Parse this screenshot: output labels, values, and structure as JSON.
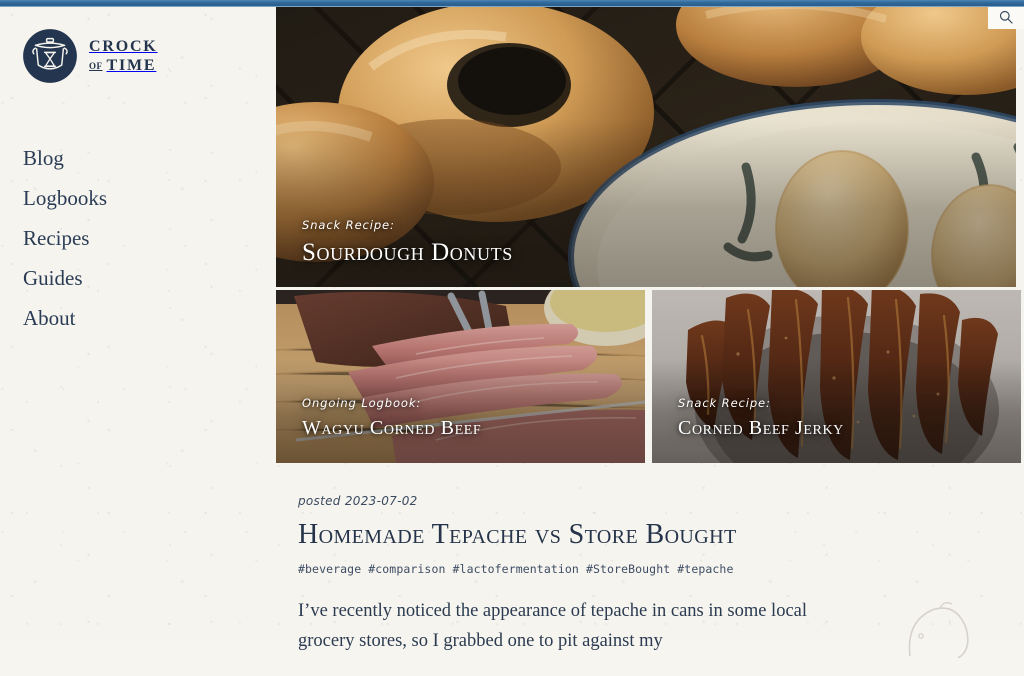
{
  "site": {
    "logo": {
      "icon": "crock-hourglass-icon",
      "line1": "CROCK",
      "of": "OF",
      "line2": "TIME"
    },
    "brand_color": "#24364f",
    "paper_color": "#f6f4ee",
    "topbar_color": "#2f6899"
  },
  "search": {
    "icon": "search-icon",
    "label": "Search"
  },
  "nav": {
    "items": [
      {
        "label": "Blog"
      },
      {
        "label": "Logbooks"
      },
      {
        "label": "Recipes"
      },
      {
        "label": "Guides"
      },
      {
        "label": "About"
      }
    ]
  },
  "features": {
    "hero": {
      "kicker": "Snack Recipe:",
      "title": "Sourdough Donuts",
      "image_description": "Golden glazed sourdough donuts cooling on a dark wire rack beside a blue-rimmed ceramic bowl of sugar-coated donut holes"
    },
    "secondary": [
      {
        "kicker": "Ongoing Logbook:",
        "title": "Wagyu Corned Beef",
        "image_description": "Sliced pink wagyu corned beef on a wooden cutting board with metal tongs"
      },
      {
        "kicker": "Snack Recipe:",
        "title": "Corned Beef Jerky",
        "image_description": "Dark reddish-brown corned beef jerky strips piled in a grey bowl"
      }
    ]
  },
  "post": {
    "date_prefix": "posted",
    "date": "2023-07-02",
    "date_full": "posted 2023-07-02",
    "title": "Homemade Tepache vs Store Bought",
    "tags": "#beverage #comparison #lactofermentation #StoreBought #tepache",
    "tag_list": [
      "#beverage",
      "#comparison",
      "#lactofermentation",
      "#StoreBought",
      "#tepache"
    ],
    "body": "I’ve recently noticed the appearance of tepache in cans in some local grocery stores, so I grabbed one to pit against my"
  }
}
